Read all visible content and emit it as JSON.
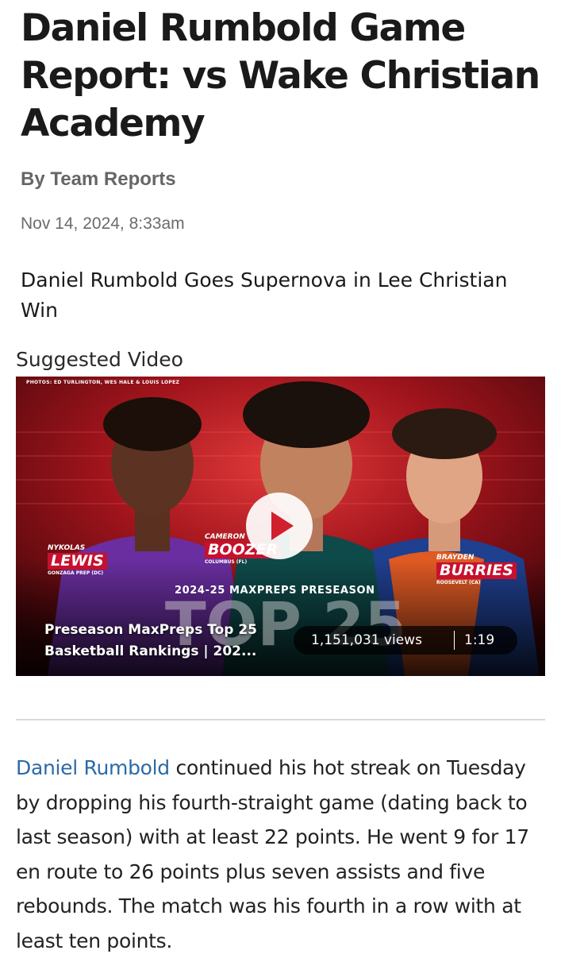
{
  "article": {
    "headline": "Daniel Rumbold Game Report: vs Wake Christian Academy",
    "byline": "By Team Reports",
    "timestamp": "Nov 14, 2024, 8:33am",
    "subtitle": "Daniel Rumbold Goes Supernova in Lee Christian Win",
    "body_link": "Daniel Rumbold",
    "body_text": " continued his hot streak on Tuesday by dropping his fourth-straight game (dating back to last season) with at least 22 points. He went 9 for 17 en route to 26 points plus seven assists and five rebounds. The match was his fourth in a row with at least ten points."
  },
  "suggested_video": {
    "label": "Suggested Video",
    "photo_credit": "PHOTOS: ED TURLINGTON, WES HALE & LOUIS LOPEZ",
    "banner": "2024-25 MAXPREPS PRESEASON",
    "big_text": "TOP 25",
    "players": [
      {
        "first": "NYKOLAS",
        "last": "LEWIS",
        "school": "GONZAGA PREP (DC)"
      },
      {
        "first": "CAMERON",
        "last": "BOOZER",
        "school": "COLUMBUS (FL)"
      },
      {
        "first": "BRAYDEN",
        "last": "BURRIES",
        "school": "ROOSEVELT (CA)"
      }
    ],
    "title": "Preseason MaxPreps Top 25 Basketball Rankings | 202...",
    "views": "1,151,031 views",
    "duration": "1:19",
    "play_icon": "play-icon"
  },
  "colors": {
    "link": "#2c6aa7",
    "video_bg": "#5a0a12",
    "accent_red": "#c8102e",
    "play_red": "#d0202e"
  }
}
